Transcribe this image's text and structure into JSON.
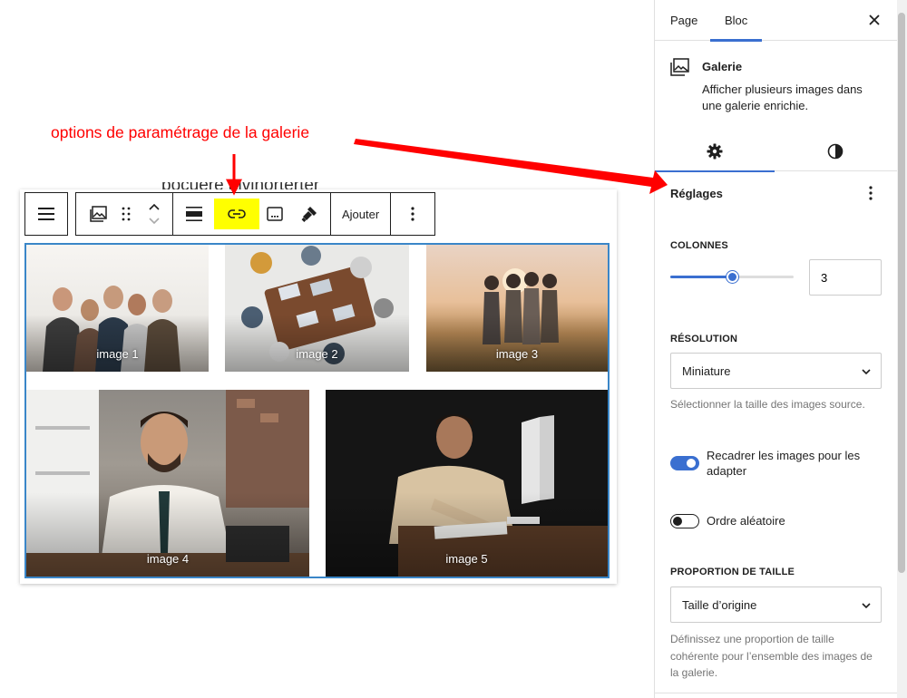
{
  "annotation": {
    "text": "options de paramétrage de la galerie"
  },
  "background_text": "pocuere aivinorterter",
  "toolbar": {
    "add_label": "Ajouter"
  },
  "gallery": {
    "images": [
      {
        "caption": "image 1"
      },
      {
        "caption": "image 2"
      },
      {
        "caption": "image 3"
      },
      {
        "caption": "image 4"
      },
      {
        "caption": "image 5"
      }
    ]
  },
  "sidebar": {
    "tabs": [
      {
        "label": "Page",
        "active": false
      },
      {
        "label": "Bloc",
        "active": true
      }
    ],
    "block": {
      "title": "Galerie",
      "description": "Afficher plusieurs images dans une galerie enrichie."
    },
    "settings": {
      "section_title": "Réglages",
      "columns": {
        "label": "COLONNES",
        "value": "3",
        "slider_fraction": 0.5
      },
      "resolution": {
        "label": "RÉSOLUTION",
        "selected": "Miniature",
        "help": "Sélectionner la taille des images source."
      },
      "crop_toggle": {
        "label": "Recadrer les images pour les adapter",
        "on": true
      },
      "random_toggle": {
        "label": "Ordre aléatoire",
        "on": false
      },
      "aspect_ratio": {
        "label": "PROPORTION DE TAILLE",
        "selected": "Taille d’origine",
        "help": "Définissez une proportion de taille cohérente pour l’ensemble des images de la galerie."
      }
    }
  },
  "colors": {
    "accent": "#3a6fd0",
    "annotation": "#ff0000",
    "highlight": "#ffff00",
    "gallery_border": "#3a86c8"
  }
}
